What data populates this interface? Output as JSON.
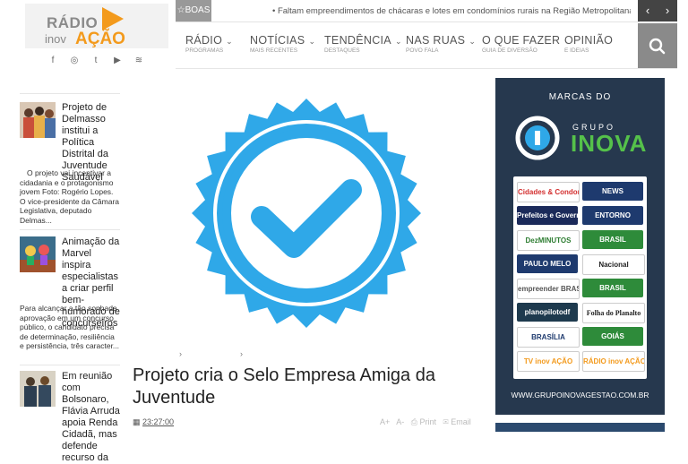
{
  "logo": {
    "line1": "RÁDIO",
    "line2": "inov",
    "line3": "AÇÃO"
  },
  "social": [
    "f",
    "◎",
    "t",
    "▶",
    "≋"
  ],
  "social_names": [
    "facebook-icon",
    "instagram-icon",
    "twitter-icon",
    "youtube-icon",
    "rss-icon"
  ],
  "ticker": {
    "label": "☆BOAS",
    "text": "• Faltam empreendimentos de chácaras e lotes em condomínios rurais na Região Metropolitana do Distrito",
    "prev": "‹",
    "next": "›"
  },
  "nav": [
    {
      "label": "RÁDIO",
      "sub": "PROGRAMAS",
      "chevron": true
    },
    {
      "label": "NOTÍCIAS",
      "sub": "MAIS RECENTES",
      "chevron": true
    },
    {
      "label": "TENDÊNCIA",
      "sub": "DESTAQUES",
      "chevron": true
    },
    {
      "label": "NAS RUAS",
      "sub": "POVO FALA",
      "chevron": true
    },
    {
      "label": "O QUE FAZER",
      "sub": "GUIA DE DIVERSÃO",
      "chevron": false
    },
    {
      "label": "OPINIÃO",
      "sub": "E IDEIAS",
      "chevron": false
    }
  ],
  "sidebar": [
    {
      "title": "Projeto de Delmasso institui a Política Distrital da Juventude Saudável",
      "desc": "O projeto vai incentivar a cidadania e o protagonismo jovem Foto: Rogério Lopes. O vice-presidente da Câmara Legislativa, deputado Delmas..."
    },
    {
      "title": "Animação da Marvel inspira especialistas a criar perfil bem-humorado de concurseiros",
      "desc": "Para alcançar a tão sonhada aprovação em um concurso público, o candidato precisa de determinação, resiliência e persistência, três caracter..."
    },
    {
      "title": "Em reunião com Bolsonaro, Flávia Arruda apoia Renda Cidadã, mas defende recurso da",
      "desc": ""
    }
  ],
  "breadcrumb": [
    "›",
    "›"
  ],
  "post": {
    "title": "Projeto cria o Selo Empresa Amiga da Juventude",
    "time": "23:27:00",
    "tools": [
      "A+",
      "A-",
      "Print",
      "Email"
    ]
  },
  "ad": {
    "header": "MARCAS DO",
    "brand_top": "GRUPO",
    "brand_name": "INOVA",
    "brands": [
      "Cidades & Condomínios",
      "NEWS",
      "Prefeitos e Governadores",
      "ENTORNO",
      "DezMINUTOS",
      "BRASIL",
      "PAULO MELO",
      "Nacional",
      "empreender BRASÍLIA",
      "BRASIL",
      "planopilotodf",
      "Folha do Planalto",
      "BRASÍLIA",
      "GOIÁS",
      "TV inov AÇÃO",
      "RÁDIO inov AÇÃO"
    ],
    "url": "WWW.GRUPOINOVAGESTAO.COM.BR"
  },
  "colors": {
    "accent": "#f39a1c",
    "badge": "#2fa8e8",
    "ad_bg": "#26384e",
    "inova_green": "#55c14a"
  }
}
